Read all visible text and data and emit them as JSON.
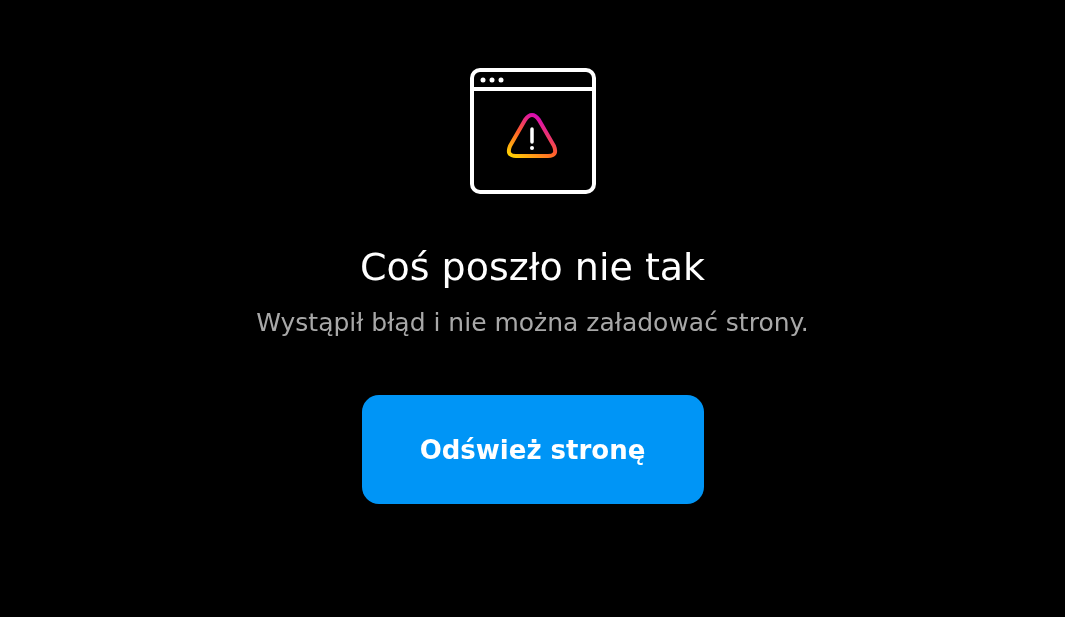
{
  "title": "Coś poszło nie tak",
  "message": "Wystąpił błąd i nie można załadować strony.",
  "button": {
    "label": "Odśwież stronę"
  }
}
